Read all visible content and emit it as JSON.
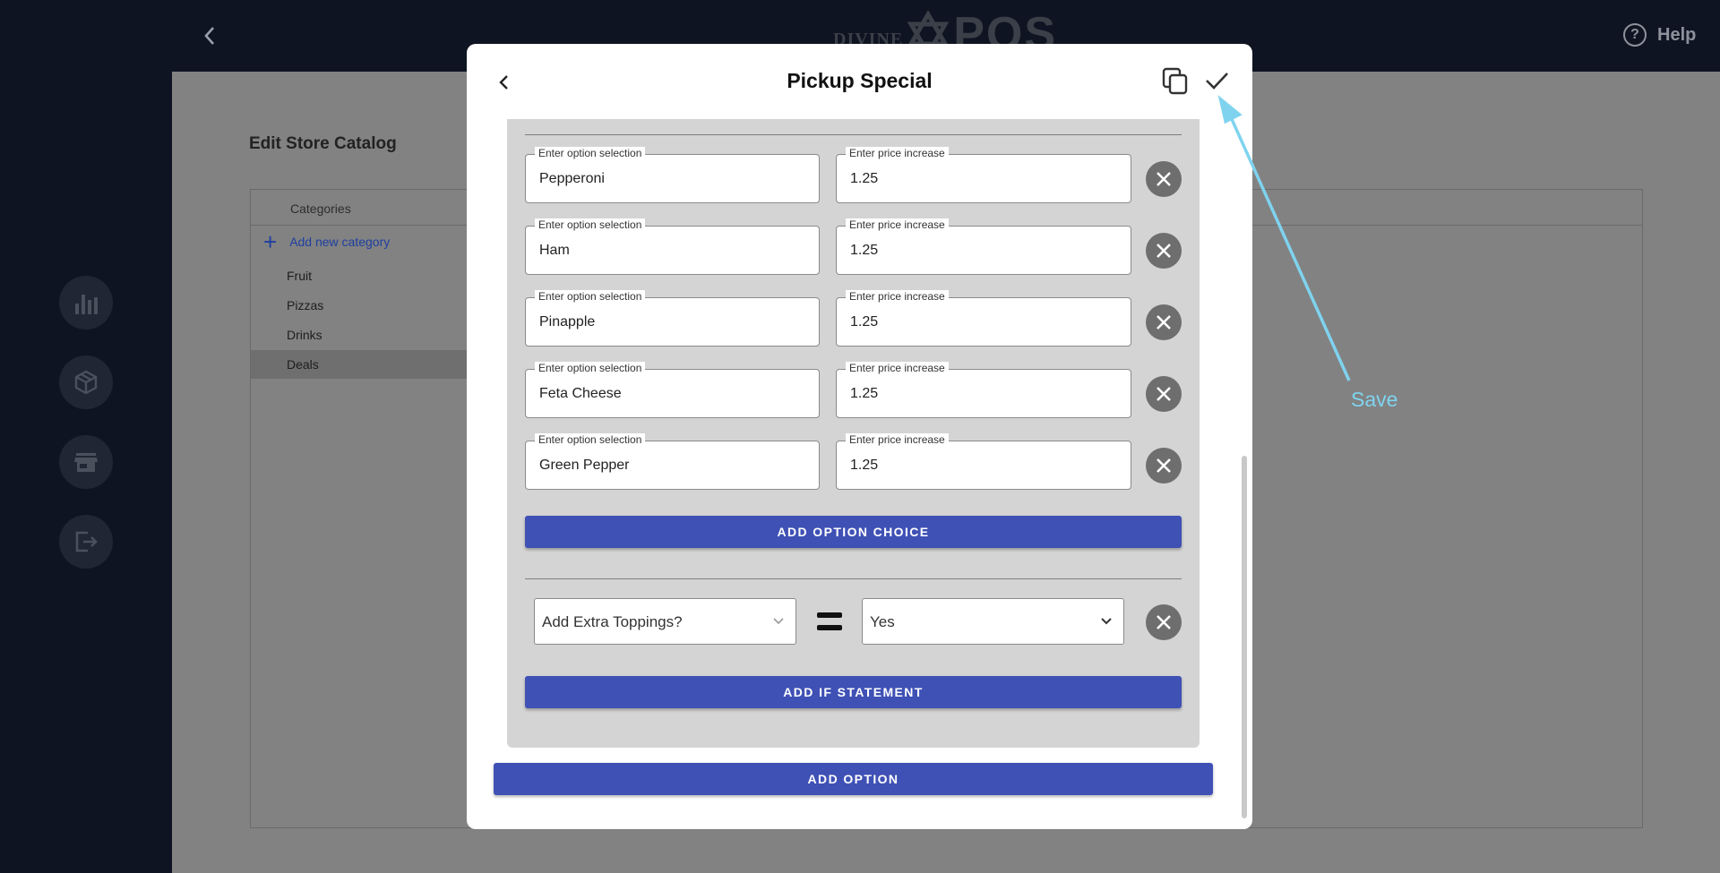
{
  "topbar": {
    "logo_left": "DIVINE",
    "logo_right": "POS",
    "help_label": "Help",
    "help_glyph": "?"
  },
  "page": {
    "title": "Edit Store Catalog",
    "categories_header": "Categories",
    "add_category_label": "Add new category",
    "add_category_glyph": "+",
    "categories": [
      {
        "label": "Fruit",
        "selected": false
      },
      {
        "label": "Pizzas",
        "selected": false
      },
      {
        "label": "Drinks",
        "selected": false
      },
      {
        "label": "Deals",
        "selected": true
      }
    ]
  },
  "rail": {
    "icons": [
      "bar-chart-icon",
      "package-icon",
      "store-icon",
      "logout-icon"
    ]
  },
  "modal": {
    "title": "Pickup Special",
    "option_choices": [
      {
        "selection_label": "Enter option selection",
        "selection": "Pepperoni",
        "price_label": "Enter price increase",
        "price": "1.25"
      },
      {
        "selection_label": "Enter option selection",
        "selection": "Ham",
        "price_label": "Enter price increase",
        "price": "1.25"
      },
      {
        "selection_label": "Enter option selection",
        "selection": "Pinapple",
        "price_label": "Enter price increase",
        "price": "1.25"
      },
      {
        "selection_label": "Enter option selection",
        "selection": "Feta Cheese",
        "price_label": "Enter price increase",
        "price": "1.25"
      },
      {
        "selection_label": "Enter option selection",
        "selection": "Green Pepper",
        "price_label": "Enter price increase",
        "price": "1.25"
      }
    ],
    "add_option_choice_label": "ADD OPTION CHOICE",
    "if_statement": {
      "left_value": "Add Extra Toppings?",
      "right_value": "Yes"
    },
    "add_if_statement_label": "ADD IF STATEMENT",
    "add_option_label": "ADD OPTION"
  },
  "annotation": {
    "label": "Save",
    "color": "#7fd3ef"
  },
  "colors": {
    "primary_button": "#3f51b5",
    "topbar": "#0e1422"
  }
}
